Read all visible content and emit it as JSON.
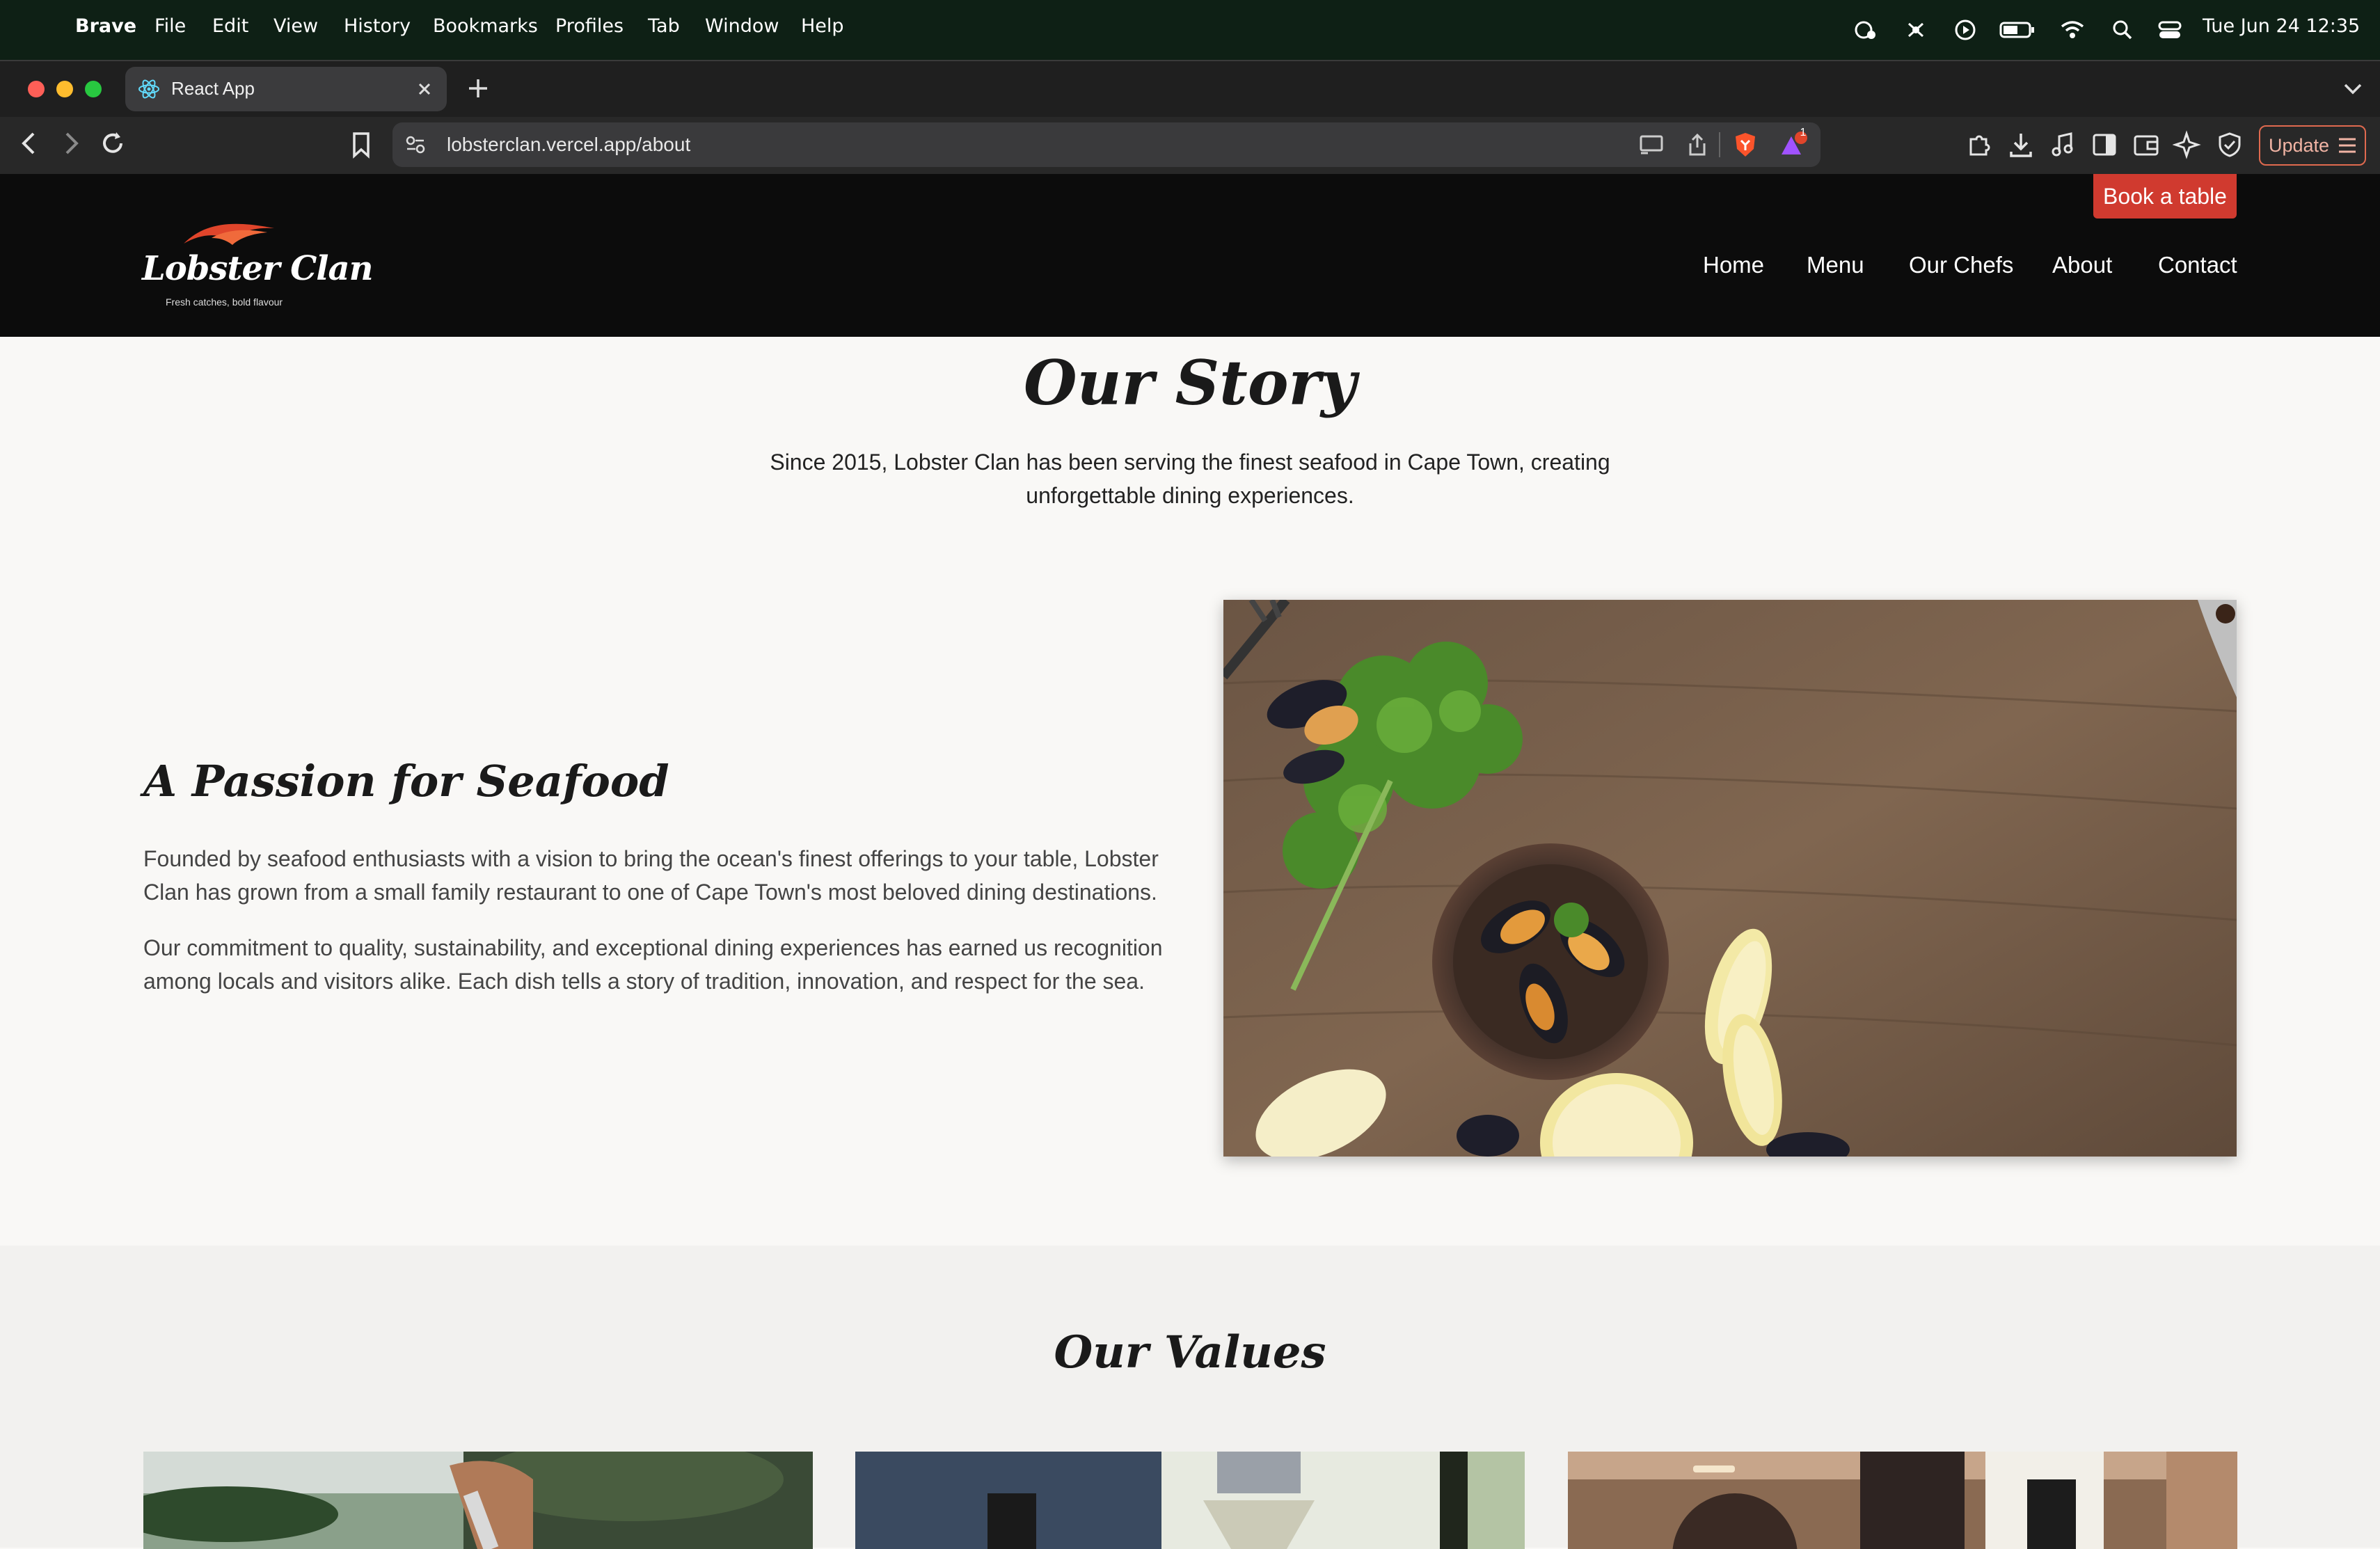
{
  "menubar": {
    "app_name": "Brave",
    "items": [
      "File",
      "Edit",
      "View",
      "History",
      "Bookmarks",
      "Profiles",
      "Tab",
      "Window",
      "Help"
    ],
    "datetime": "Tue Jun 24  12:35"
  },
  "browser": {
    "tab_title": "React App",
    "url": "lobsterclan.vercel.app/about",
    "notification_count": "1",
    "update_label": "Update"
  },
  "site": {
    "logo_name": "Lobster Clan",
    "logo_tagline": "Fresh catches, bold flavour",
    "book_button": "Book a table",
    "nav": [
      "Home",
      "Menu",
      "Our Chefs",
      "About",
      "Contact"
    ]
  },
  "story": {
    "title": "Our Story",
    "subtitle_line1": "Since 2015, Lobster Clan has been serving the finest seafood in Cape Town, creating",
    "subtitle_line2": "unforgettable dining experiences."
  },
  "passion": {
    "heading": "A Passion for Seafood",
    "para1_line1": "Founded by seafood enthusiasts with a vision to bring the ocean's finest offerings to your table, Lobster",
    "para1_line2": "Clan has grown from a small family restaurant to one of Cape Town's most beloved dining destinations.",
    "para2_line1": "Our commitment to quality, sustainability, and exceptional dining experiences has earned us recognition",
    "para2_line2": "among locals and visitors alike. Each dish tells a story of tradition, innovation, and respect for the sea."
  },
  "values": {
    "title": "Our Values"
  },
  "colors": {
    "accent": "#d03a2f",
    "nav_bg": "#0c0c0c",
    "page_bg": "#f9f8f6",
    "menubar_bg": "#0e2015"
  }
}
